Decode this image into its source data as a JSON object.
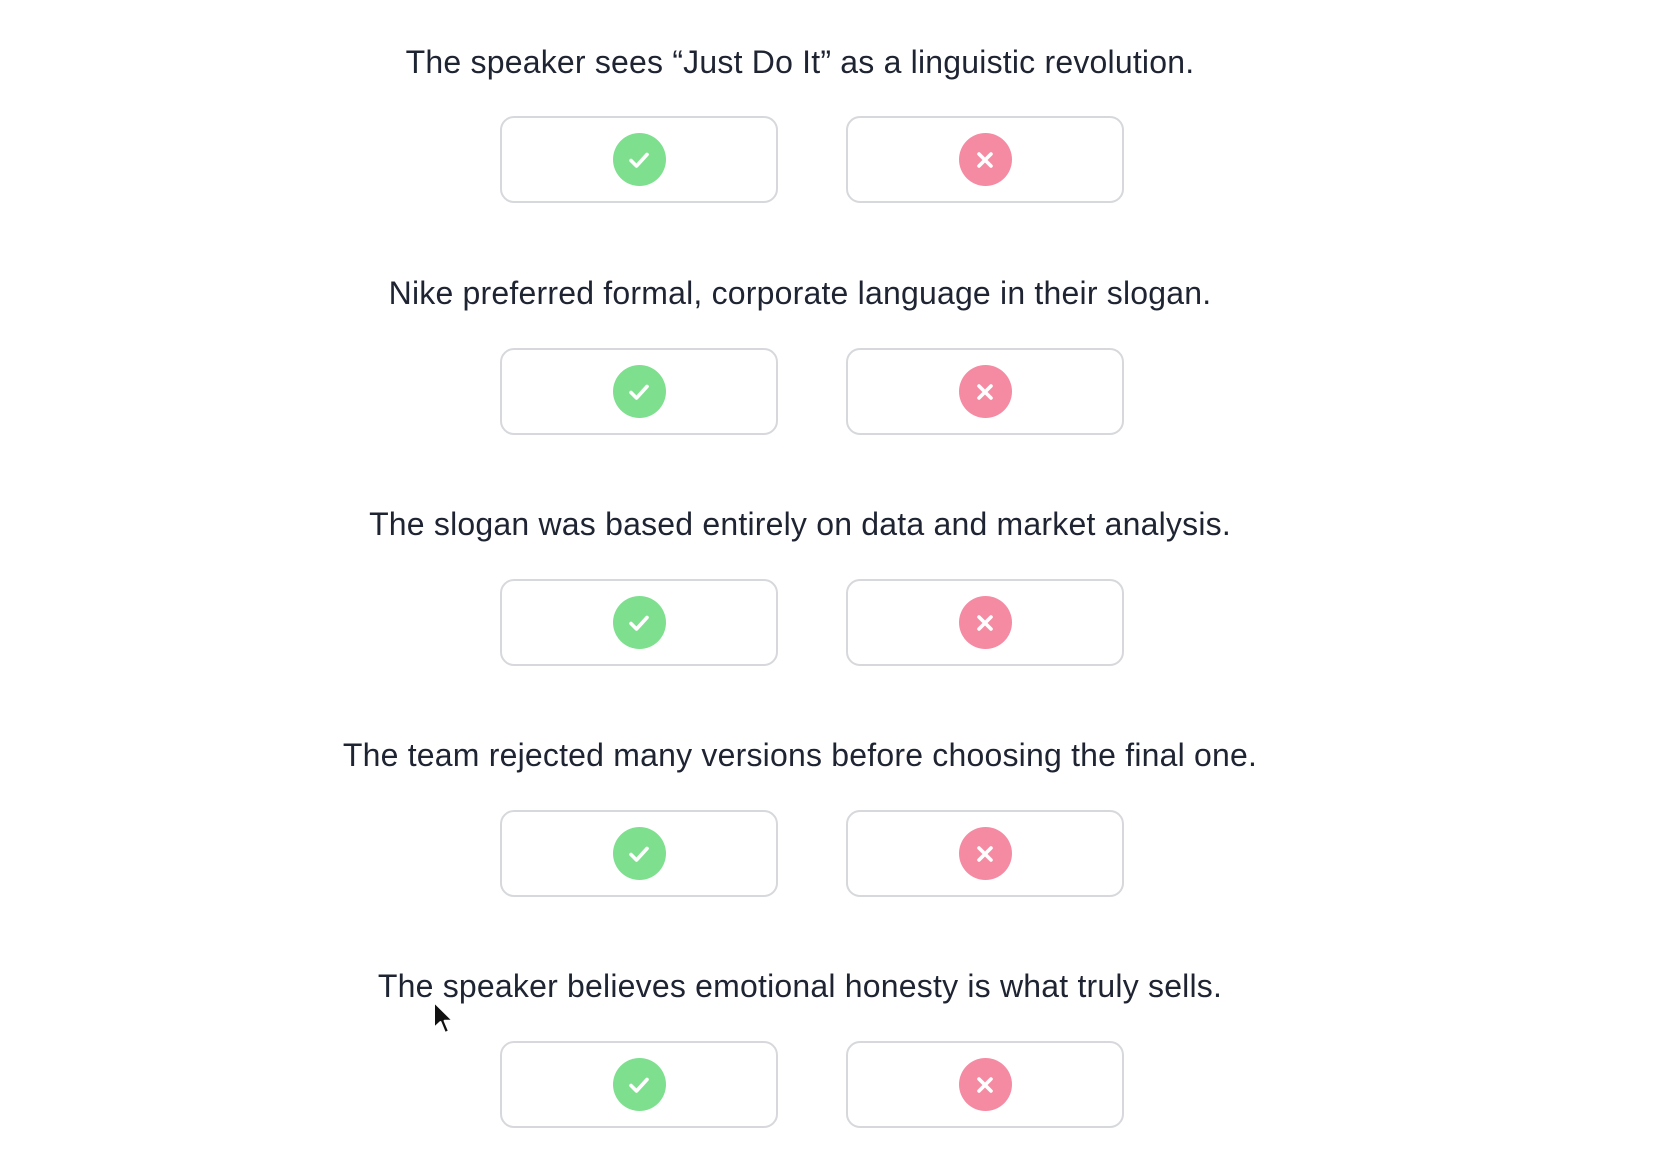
{
  "colors": {
    "true_icon": "#7ee08e",
    "false_icon": "#f58ba3",
    "text": "#1f2433",
    "border": "#d6d8dc"
  },
  "icons": {
    "true": "check-icon",
    "false": "cross-icon"
  },
  "questions": [
    {
      "text": "The speaker sees “Just Do It” as a linguistic revolution."
    },
    {
      "text": "Nike preferred formal, corporate language in their slogan."
    },
    {
      "text": "The slogan was based entirely on data and market analysis."
    },
    {
      "text": "The team rejected many versions before choosing the final one."
    },
    {
      "text": "The speaker believes emotional honesty is what truly sells."
    }
  ]
}
